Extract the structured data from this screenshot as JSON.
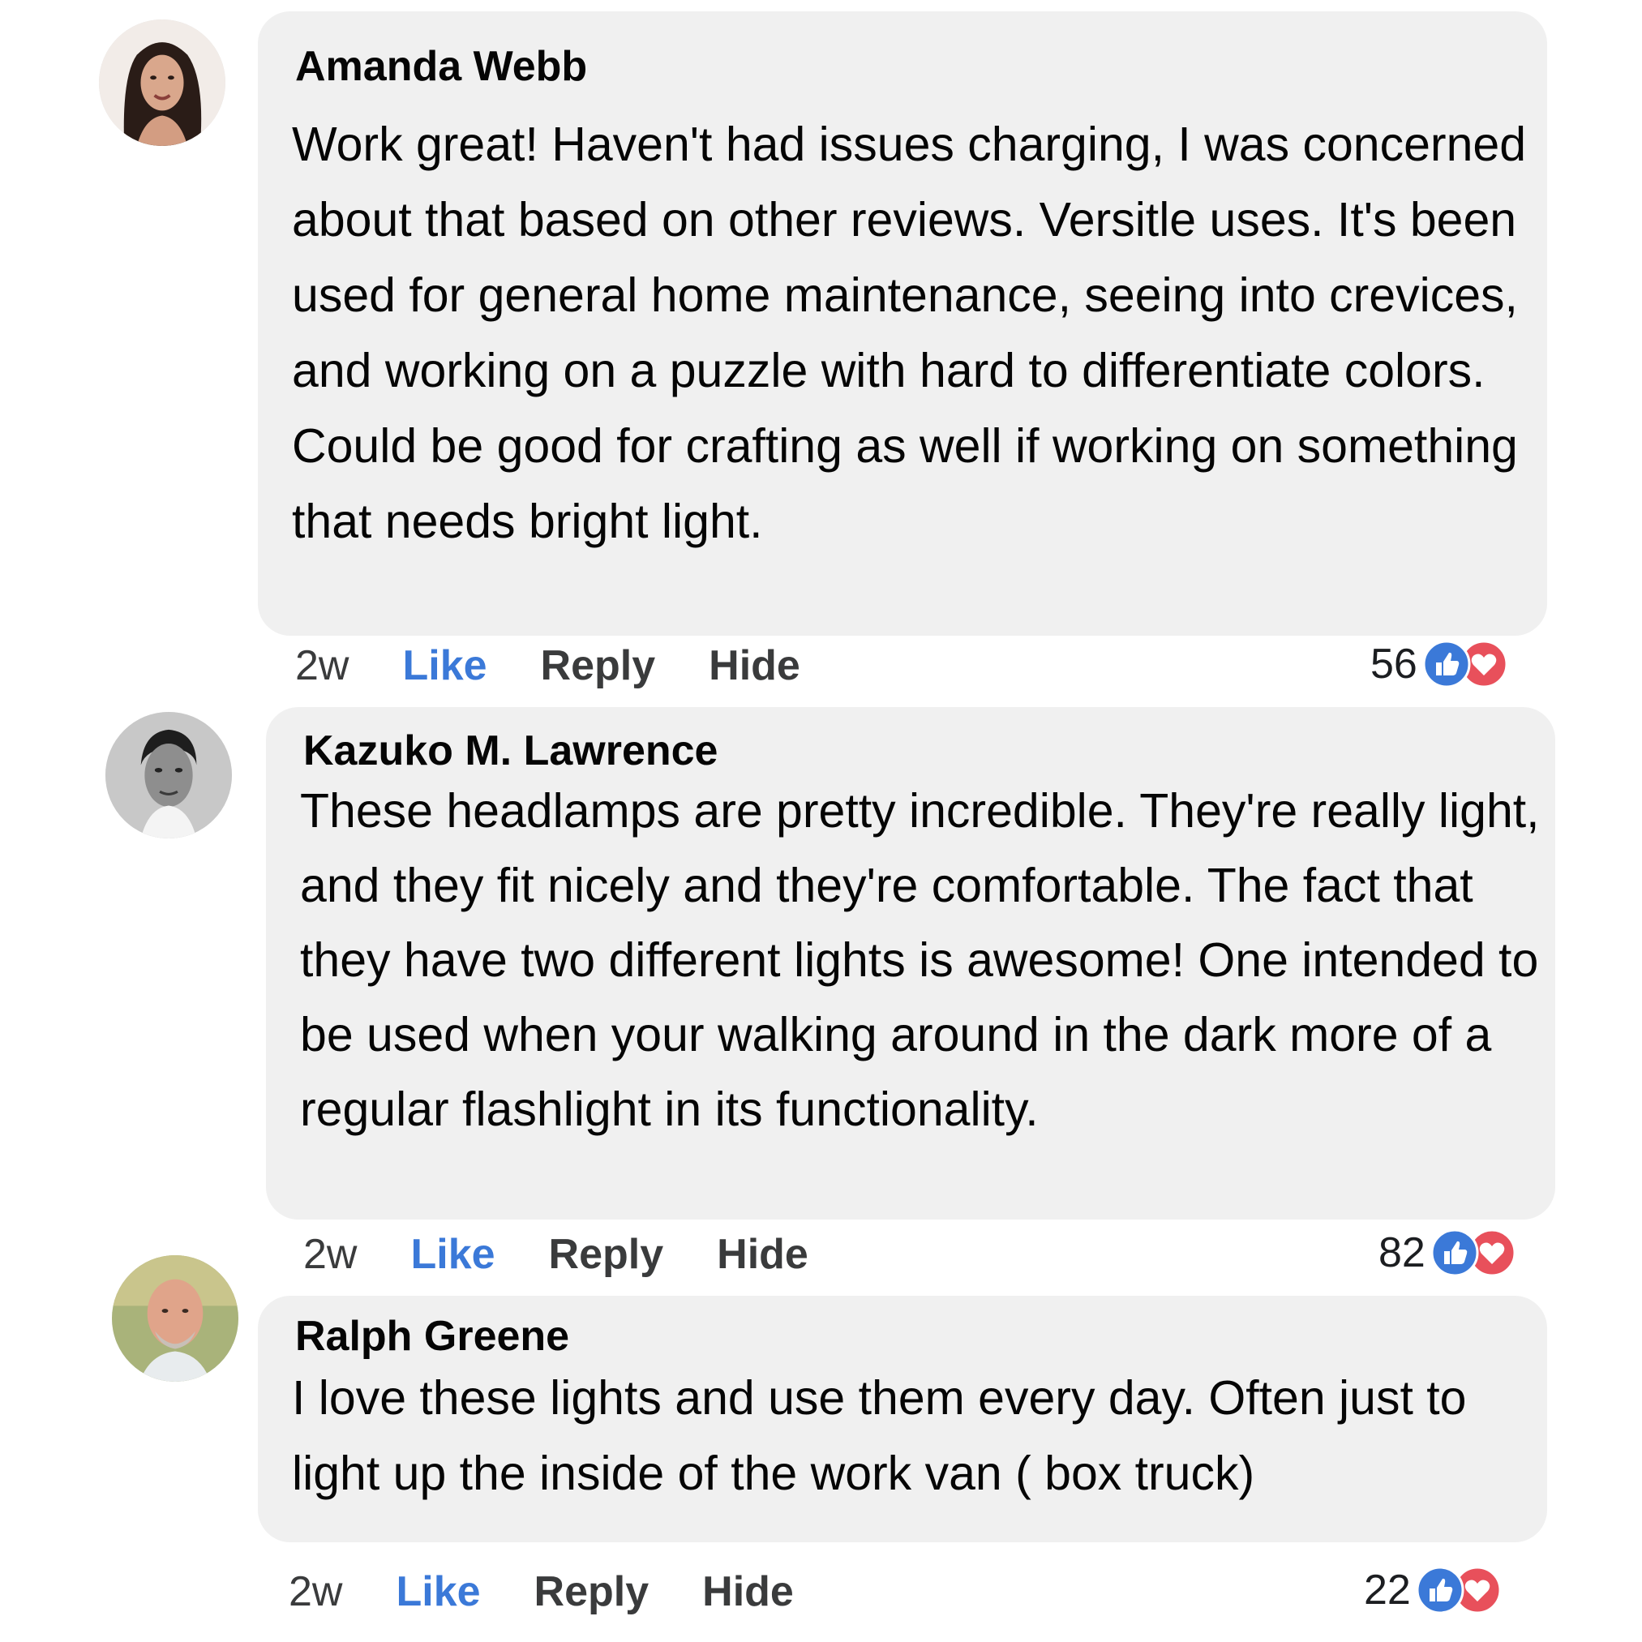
{
  "colors": {
    "bubble": "#f0f0f0",
    "like_blue": "#3b79d8",
    "love_red": "#e8505b"
  },
  "comments": [
    {
      "author": "Amanda Webb",
      "text": "Work great! Haven't had issues charging, I was concerned about that based on other reviews. Versitle uses. It's been used for general home maintenance, seeing into crevices, and working on a puzzle with hard to differentiate colors. Could be good for crafting as well if working on something that needs bright light.",
      "time": "2w",
      "like": "Like",
      "reply": "Reply",
      "hide": "Hide",
      "reactions": "56"
    },
    {
      "author": "Kazuko M. Lawrence",
      "text": "These headlamps are pretty incredible. They're really light, and they fit nicely and they're comfortable. The fact that they have two different lights is awesome! One intended to be used when your walking around in the dark more of a regular flashlight in its functionality.",
      "time": "2w",
      "like": "Like",
      "reply": "Reply",
      "hide": "Hide",
      "reactions": "82"
    },
    {
      "author": "Ralph Greene",
      "text": "I love these lights and use them every day. Often just to light up the inside of the work van ( box truck)",
      "time": "2w",
      "like": "Like",
      "reply": "Reply",
      "hide": "Hide",
      "reactions": "22"
    }
  ]
}
